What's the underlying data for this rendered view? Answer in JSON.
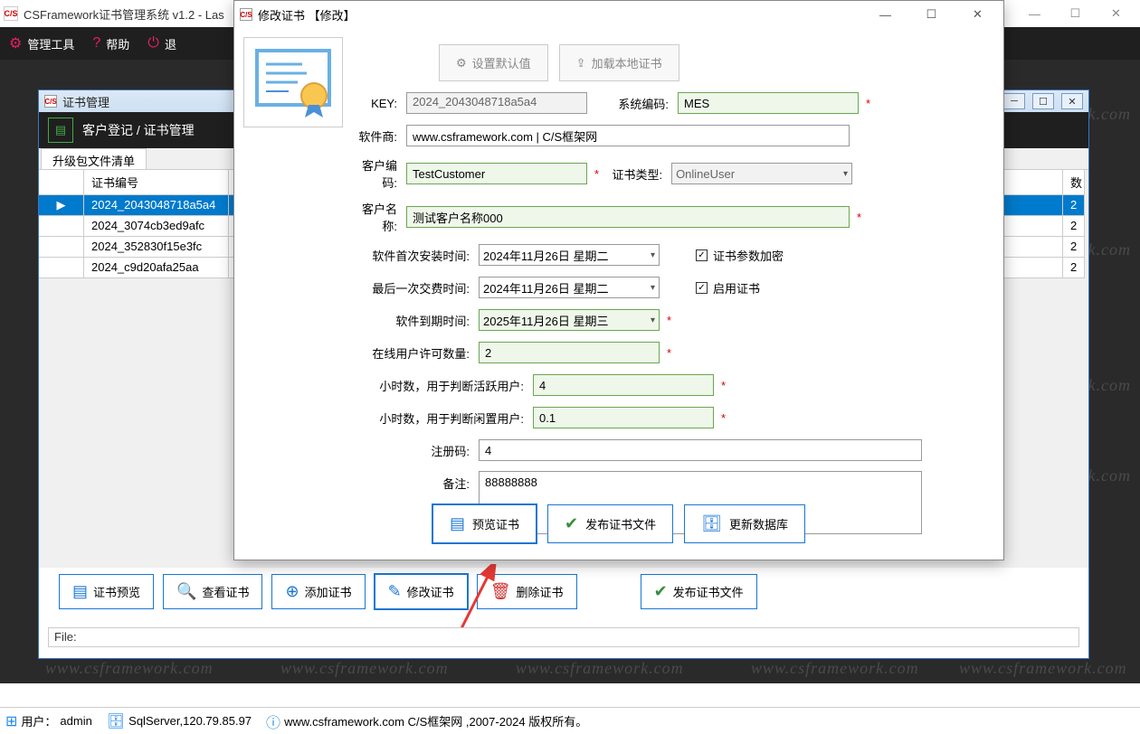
{
  "outer": {
    "title": "CSFramework证书管理系统 v1.2 - Las",
    "appIcon": "C/S",
    "min": "—",
    "max": "☐",
    "close": "✕"
  },
  "menubar": {
    "tools": "管理工具",
    "help": "帮助",
    "login": "退"
  },
  "childWindow": {
    "title": "证书管理",
    "header": "客户登记 / 证书管理",
    "tab": "升级包文件清单",
    "columns": {
      "id": "证书编号"
    },
    "rows": [
      {
        "id": "2024_2043048718a5a4",
        "num": "2",
        "selected": true
      },
      {
        "id": "2024_3074cb3ed9afc",
        "num": "2",
        "selected": false
      },
      {
        "id": "2024_352830f15e3fc",
        "num": "2",
        "selected": false
      },
      {
        "id": "2024_c9d20afa25aa",
        "num": "2",
        "selected": false
      }
    ],
    "filebar": "File:",
    "toolbar": {
      "preview": "证书预览",
      "view": "查看证书",
      "add": "添加证书",
      "edit": "修改证书",
      "del": "删除证书",
      "publish": "发布证书文件"
    }
  },
  "dialog": {
    "title": "修改证书 【修改】",
    "topButtons": {
      "setDefault": "设置默认值",
      "loadLocal": "加载本地证书"
    },
    "labels": {
      "key": "KEY:",
      "sysCode": "系统编码:",
      "vendor": "软件商:",
      "custCode": "客户编码:",
      "certType": "证书类型:",
      "custName": "客户名称:",
      "firstInstall": "软件首次安装时间:",
      "lastCharge": "最后一次交费时间:",
      "expire": "软件到期时间:",
      "onlineLic": "在线用户许可数量:",
      "activeHours": "小时数，用于判断活跃用户:",
      "idleHours": "小时数，用于判断闲置用户:",
      "regCode": "注册码:",
      "remark": "备注:",
      "encrypt": "证书参数加密",
      "enable": "启用证书"
    },
    "values": {
      "key": "2024_2043048718a5a4",
      "sysCode": "MES",
      "vendor": "www.csframework.com | C/S框架网",
      "custCode": "TestCustomer",
      "certType": "OnlineUser",
      "custName": "测试客户名称000",
      "firstInstall": "2024年11月26日 星期二",
      "lastCharge": "2024年11月26日 星期二",
      "expire": "2025年11月26日 星期三",
      "onlineLic": "2",
      "activeHours": "4",
      "idleHours": "0.1",
      "regCode": "4",
      "remark": "88888888"
    },
    "footer": {
      "preview": "预览证书",
      "publish": "发布证书文件",
      "updateDb": "更新数据库"
    }
  },
  "statusbar": {
    "userLabel": "用户：",
    "user": "admin",
    "db": "SqlServer,120.79.85.97",
    "link": "www.csframework.com C/S框架网 ,2007-2024 版权所有。"
  },
  "watermark": "www.csframework.com"
}
